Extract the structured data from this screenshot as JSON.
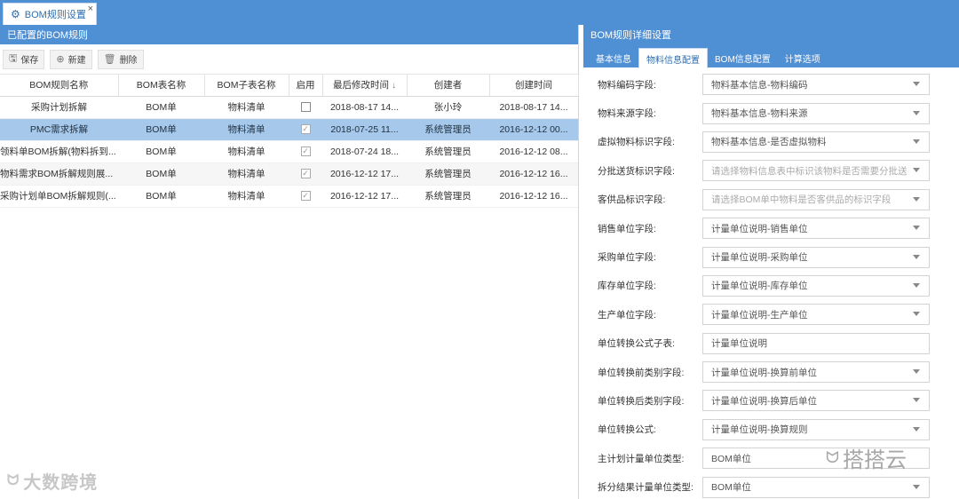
{
  "window_tab": {
    "icon": "gear-icon",
    "label": "BOM规则设置",
    "close": "×"
  },
  "left": {
    "title": "已配置的BOM规则",
    "toolbar": {
      "save": "保存",
      "new": "新建",
      "delete": "删除"
    },
    "columns": [
      "BOM规则名称",
      "BOM表名称",
      "BOM子表名称",
      "启用",
      "最后修改时间",
      "创建者",
      "创建时间"
    ],
    "sort_icon": "↓",
    "rows": [
      {
        "name": "采购计划拆解",
        "bom": "BOM单",
        "sub": "物料清单",
        "enabled": false,
        "modified": "2018-08-17 14...",
        "creator": "张小玲",
        "created": "2018-08-17 14..."
      },
      {
        "name": "PMC需求拆解",
        "bom": "BOM单",
        "sub": "物料清单",
        "enabled": true,
        "modified": "2018-07-25 11...",
        "creator": "系统管理员",
        "created": "2016-12-12 00..."
      },
      {
        "name": "领料单BOM拆解(物料拆到...",
        "bom": "BOM单",
        "sub": "物料清单",
        "enabled": true,
        "modified": "2018-07-24 18...",
        "creator": "系统管理员",
        "created": "2016-12-12 08..."
      },
      {
        "name": "物料需求BOM拆解规则展...",
        "bom": "BOM单",
        "sub": "物料清单",
        "enabled": true,
        "modified": "2016-12-12 17...",
        "creator": "系统管理员",
        "created": "2016-12-12 16..."
      },
      {
        "name": "采购计划单BOM拆解规则(...",
        "bom": "BOM单",
        "sub": "物料清单",
        "enabled": true,
        "modified": "2016-12-12 17...",
        "creator": "系统管理员",
        "created": "2016-12-12 16..."
      }
    ]
  },
  "right": {
    "title": "BOM规则详细设置",
    "tabs": [
      "基本信息",
      "物料信息配置",
      "BOM信息配置",
      "计算选项"
    ],
    "active_tab": 1,
    "fields": [
      {
        "label": "物料编码字段:",
        "value": "物料基本信息-物料编码",
        "placeholder": false,
        "dropdown": true
      },
      {
        "label": "物料来源字段:",
        "value": "物料基本信息-物料来源",
        "placeholder": false,
        "dropdown": true
      },
      {
        "label": "虚拟物料标识字段:",
        "value": "物料基本信息-是否虚拟物料",
        "placeholder": false,
        "dropdown": true
      },
      {
        "label": "分批送货标识字段:",
        "value": "请选择物料信息表中标识该物料是否需要分批送",
        "placeholder": true,
        "dropdown": true
      },
      {
        "label": "客供品标识字段:",
        "value": "请选择BOM单中物料是否客供品的标识字段",
        "placeholder": true,
        "dropdown": true
      },
      {
        "label": "销售单位字段:",
        "value": "计量单位说明-销售单位",
        "placeholder": false,
        "dropdown": true
      },
      {
        "label": "采购单位字段:",
        "value": "计量单位说明-采购单位",
        "placeholder": false,
        "dropdown": true
      },
      {
        "label": "库存单位字段:",
        "value": "计量单位说明-库存单位",
        "placeholder": false,
        "dropdown": true
      },
      {
        "label": "生产单位字段:",
        "value": "计量单位说明-生产单位",
        "placeholder": false,
        "dropdown": true
      },
      {
        "label": "单位转换公式子表:",
        "value": "计量单位说明",
        "placeholder": false,
        "dropdown": false
      },
      {
        "label": "单位转换前类别字段:",
        "value": "计量单位说明-换算前单位",
        "placeholder": false,
        "dropdown": true
      },
      {
        "label": "单位转换后类别字段:",
        "value": "计量单位说明-换算后单位",
        "placeholder": false,
        "dropdown": true
      },
      {
        "label": "单位转换公式:",
        "value": "计量单位说明-换算规则",
        "placeholder": false,
        "dropdown": true
      },
      {
        "label": "主计划计量单位类型:",
        "value": "BOM单位",
        "placeholder": false,
        "dropdown": false
      },
      {
        "label": "拆分结果计量单位类型:",
        "value": "BOM单位",
        "placeholder": false,
        "dropdown": true
      }
    ]
  },
  "watermarks": {
    "left": "大数跨境",
    "right": "搭搭云"
  },
  "colors": {
    "header_blue": "#4f8fd4",
    "selected_row": "#a6c8ea"
  }
}
